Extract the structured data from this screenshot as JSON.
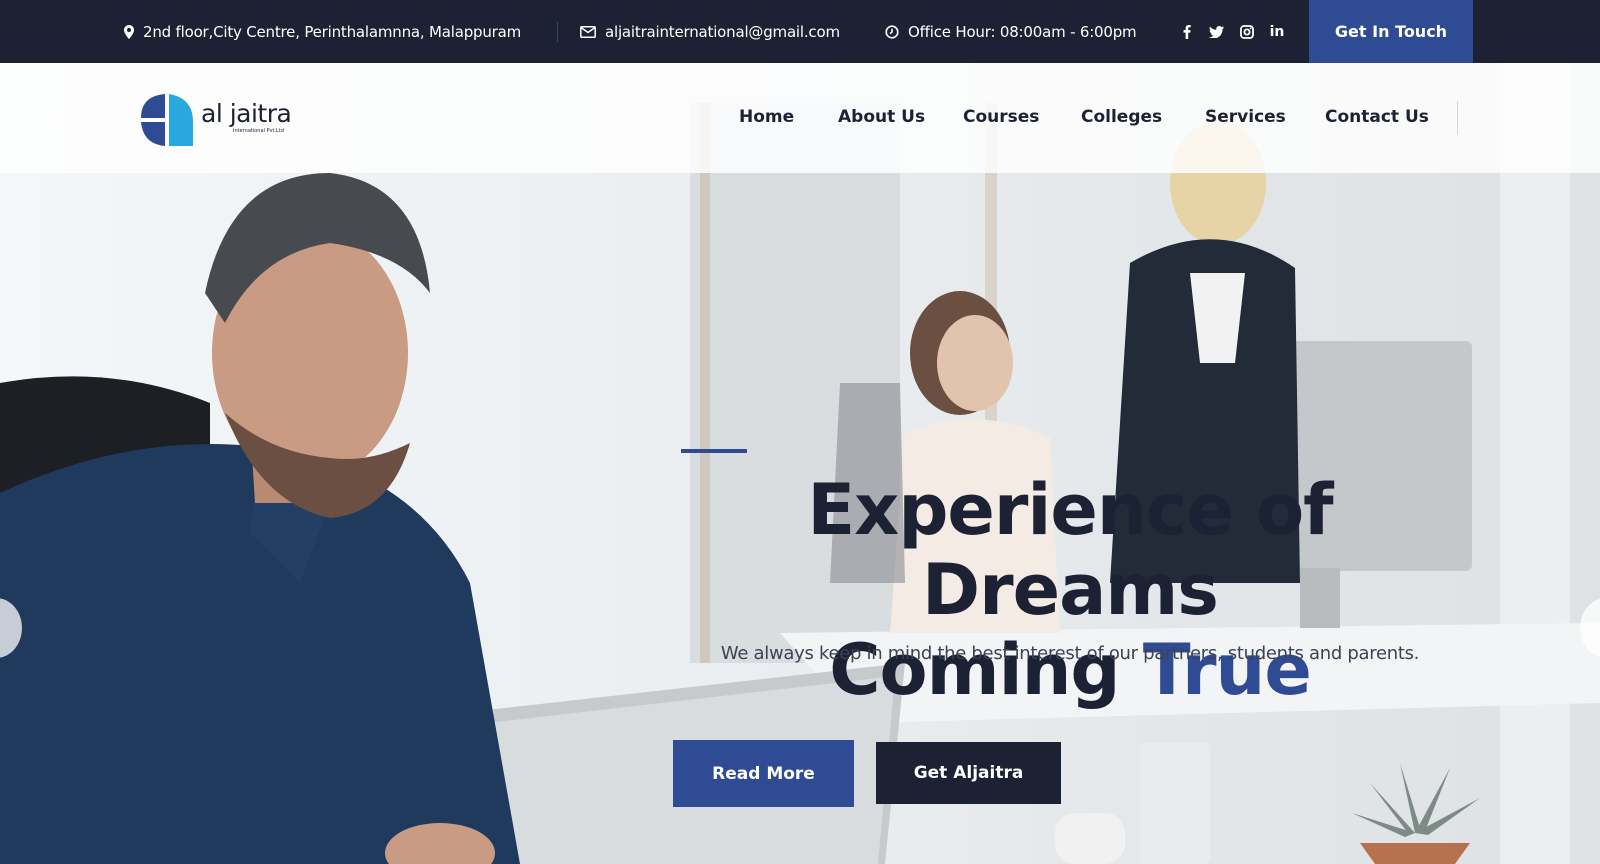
{
  "topbar": {
    "address": "2nd floor,City Centre, Perinthalamnna, Malappuram",
    "email": "aljaitrainternational@gmail.com",
    "office_hours": "Office Hour: 08:00am - 6:00pm",
    "social_icons": [
      "facebook-icon",
      "twitter-icon",
      "instagram-icon",
      "linkedin-icon"
    ],
    "linkedin_label": "in",
    "cta_label": "Get In Touch"
  },
  "brand": {
    "name": "al jaitra",
    "tagline": "International Pvt.Ltd"
  },
  "nav": {
    "items": [
      {
        "label": "Home"
      },
      {
        "label": "About Us"
      },
      {
        "label": "Courses"
      },
      {
        "label": "Colleges"
      },
      {
        "label": "Services"
      },
      {
        "label": "Contact Us"
      }
    ]
  },
  "hero": {
    "headline_line1": "Experience of Dreams",
    "headline_line2_a": "Coming ",
    "headline_line2_b": "True",
    "subtext": "We always keep in mind the best interest of our partners, students and parents.",
    "primary_button": "Read More",
    "secondary_button": "Get Aljaitra"
  },
  "colors": {
    "topbar_bg": "#1c2233",
    "accent": "#2f4b93",
    "dark": "#1c2233",
    "logo_blue": "#29a8e0"
  }
}
